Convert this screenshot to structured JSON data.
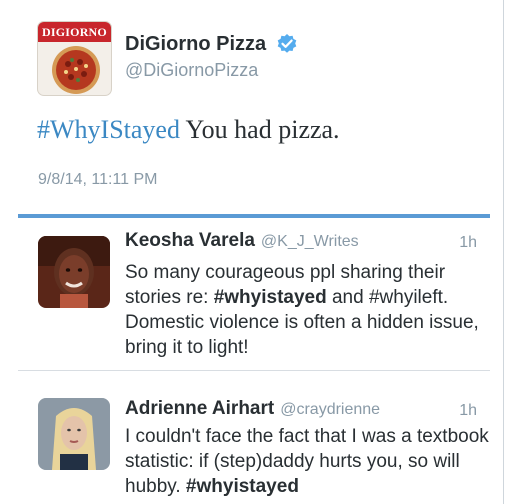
{
  "main_tweet": {
    "brand_logo_text": "DIGIORNO",
    "display_name": "DiGiorno Pizza",
    "handle": "@DiGiornoPizza",
    "hashtag": "#WhyIStayed",
    "text": " You had pizza.",
    "timestamp": "9/8/14, 11:11 PM",
    "accent_color": "#3b88c3"
  },
  "replies": [
    {
      "display_name": "Keosha Varela",
      "handle": "@K_J_Writes",
      "time": "1h",
      "text_part1": "So many courageous ppl sharing their stories re: ",
      "hashtag1": "#whyistayed",
      "text_part2": " and #whyileft. Domestic violence is often a hidden issue, bring it to light!"
    },
    {
      "display_name": "Adrienne Airhart",
      "handle": "@craydrienne",
      "time": "1h",
      "text_part1": "I couldn't face the fact that I was a textbook statistic: if (step)daddy hurts you, so will hubby. ",
      "hashtag1": "#whyistayed"
    }
  ],
  "colors": {
    "divider_blue": "#5b9bd5",
    "muted_text": "#8899a6",
    "verified_blue": "#55acee"
  }
}
